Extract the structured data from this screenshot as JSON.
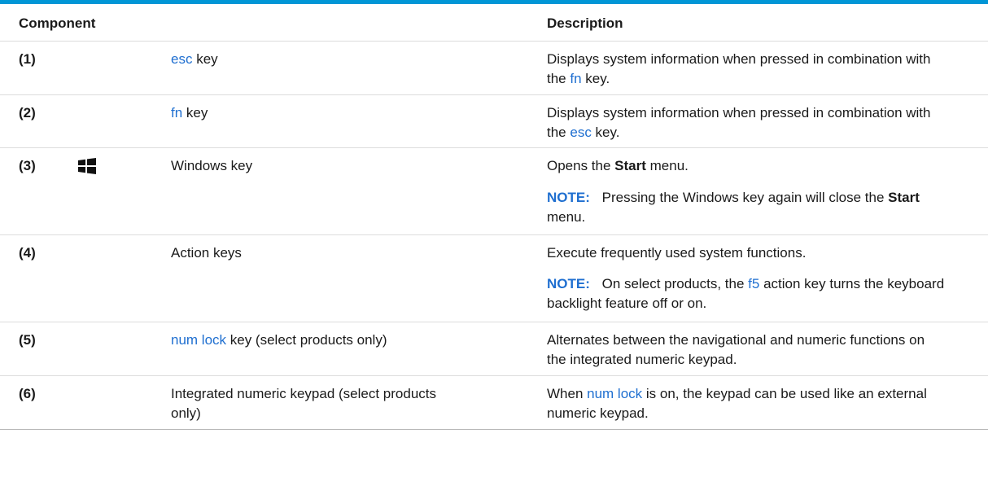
{
  "headers": {
    "component": "Component",
    "description": "Description"
  },
  "rows": [
    {
      "num": "(1)",
      "component": {
        "link": "esc",
        "rest": " key"
      },
      "description": {
        "line1": "Displays system information when pressed in combination with",
        "line2_pre": "the ",
        "line2_link": "fn",
        "line2_post": " key."
      }
    },
    {
      "num": "(2)",
      "component": {
        "link": "fn",
        "rest": " key"
      },
      "description": {
        "line1": "Displays system information when pressed in combination with",
        "line2_pre": "the ",
        "line2_link": "esc",
        "line2_post": " key."
      }
    },
    {
      "num": "(3)",
      "icon": "windows-logo-icon",
      "component": {
        "text": "Windows key"
      },
      "description": {
        "pre": "Opens the ",
        "bold": "Start",
        "post": " menu.",
        "note_label": "NOTE:",
        "note_pre": "Pressing the Windows key again will close the ",
        "note_bold": "Start",
        "note_post": "menu."
      }
    },
    {
      "num": "(4)",
      "component": {
        "text": "Action keys"
      },
      "description": {
        "text": "Execute frequently used system functions.",
        "note_label": "NOTE:",
        "note_pre": "On select products, the ",
        "note_link": "f5",
        "note_post": " action key turns the keyboard",
        "note_line2": "backlight feature off or on."
      }
    },
    {
      "num": "(5)",
      "component": {
        "link": "num lock",
        "rest": " key (select products only)"
      },
      "description": {
        "line1": "Alternates between the navigational and numeric functions on",
        "line2": "the integrated numeric keypad."
      }
    },
    {
      "num": "(6)",
      "component": {
        "line1": "Integrated numeric keypad (select products",
        "line2": "only)"
      },
      "description": {
        "line1_pre": "When ",
        "line1_link": "num lock",
        "line1_post": " is on, the keypad can be used like an external",
        "line2": "numeric keypad."
      }
    }
  ]
}
